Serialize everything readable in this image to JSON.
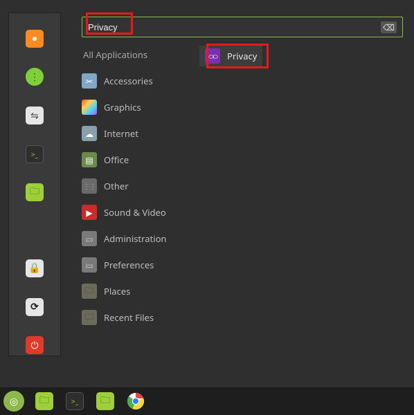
{
  "colors": {
    "accent": "#8fb84b",
    "highlight": "#e51b1b"
  },
  "search": {
    "value": "Privacy",
    "clear_icon": "⌫"
  },
  "categories": {
    "header": "All Applications",
    "items": [
      {
        "label": "Accessories",
        "icon": "accessories-icon",
        "bg": "#7fa8c8",
        "glyph": "✂"
      },
      {
        "label": "Graphics",
        "icon": "graphics-icon",
        "bg": "linear-gradient(135deg,#ff4d4d,#ffd24d,#4dd2ff,#b84dff)",
        "glyph": ""
      },
      {
        "label": "Internet",
        "icon": "internet-icon",
        "bg": "#8aa0ab",
        "glyph": "☁"
      },
      {
        "label": "Office",
        "icon": "office-icon",
        "bg": "#6e8a4a",
        "glyph": "▤"
      },
      {
        "label": "Other",
        "icon": "other-icon",
        "bg": "#6a6a6a",
        "glyph": "⋮⋮"
      },
      {
        "label": "Sound & Video",
        "icon": "sound-video-icon",
        "bg": "#cc2b2b",
        "glyph": "▶"
      },
      {
        "label": "Administration",
        "icon": "administration-icon",
        "bg": "#7a7a7a",
        "glyph": "▭"
      },
      {
        "label": "Preferences",
        "icon": "preferences-icon",
        "bg": "#7a7a7a",
        "glyph": "▭"
      },
      {
        "label": "Places",
        "icon": "places-icon",
        "bg": "#6b6b5a",
        "glyph": "🗀"
      },
      {
        "label": "Recent Files",
        "icon": "recent-icon",
        "bg": "#6b6b5a",
        "glyph": "🗀"
      }
    ]
  },
  "results": [
    {
      "label": "Privacy",
      "icon": "privacy-icon",
      "bg": "#7b2fb0",
      "glyph": "⬭⬭"
    }
  ],
  "favorites": [
    {
      "name": "firefox",
      "bg": "#ff8a1f",
      "glyph": "●"
    },
    {
      "name": "apps",
      "bg": "#7fcf3a",
      "glyph": "⋮⋮⋮"
    },
    {
      "name": "settings-switch",
      "bg": "#e6e6e6",
      "glyph": "⇋"
    },
    {
      "name": "terminal",
      "bg": "#2e2e2e",
      "glyph": ">_"
    },
    {
      "name": "files",
      "bg": "#9ecf3a",
      "glyph": "🗀"
    },
    {
      "name": "lock",
      "bg": "#e6e6e6",
      "glyph": "🔒"
    },
    {
      "name": "restart",
      "bg": "#e6e6e6",
      "glyph": "⟳"
    },
    {
      "name": "power",
      "bg": "#e03a2a",
      "glyph": "⏻"
    }
  ],
  "taskbar": [
    {
      "name": "mint-menu",
      "bg": "#8fb84b",
      "glyph": "◎"
    },
    {
      "name": "files-app",
      "bg": "#9ecf3a",
      "glyph": "🗀"
    },
    {
      "name": "terminal-app",
      "bg": "#2e2e2e",
      "glyph": ">_"
    },
    {
      "name": "files-app-2",
      "bg": "#9ecf3a",
      "glyph": "🗀"
    },
    {
      "name": "chrome",
      "bg": "#ffffff",
      "glyph": "◉"
    }
  ]
}
